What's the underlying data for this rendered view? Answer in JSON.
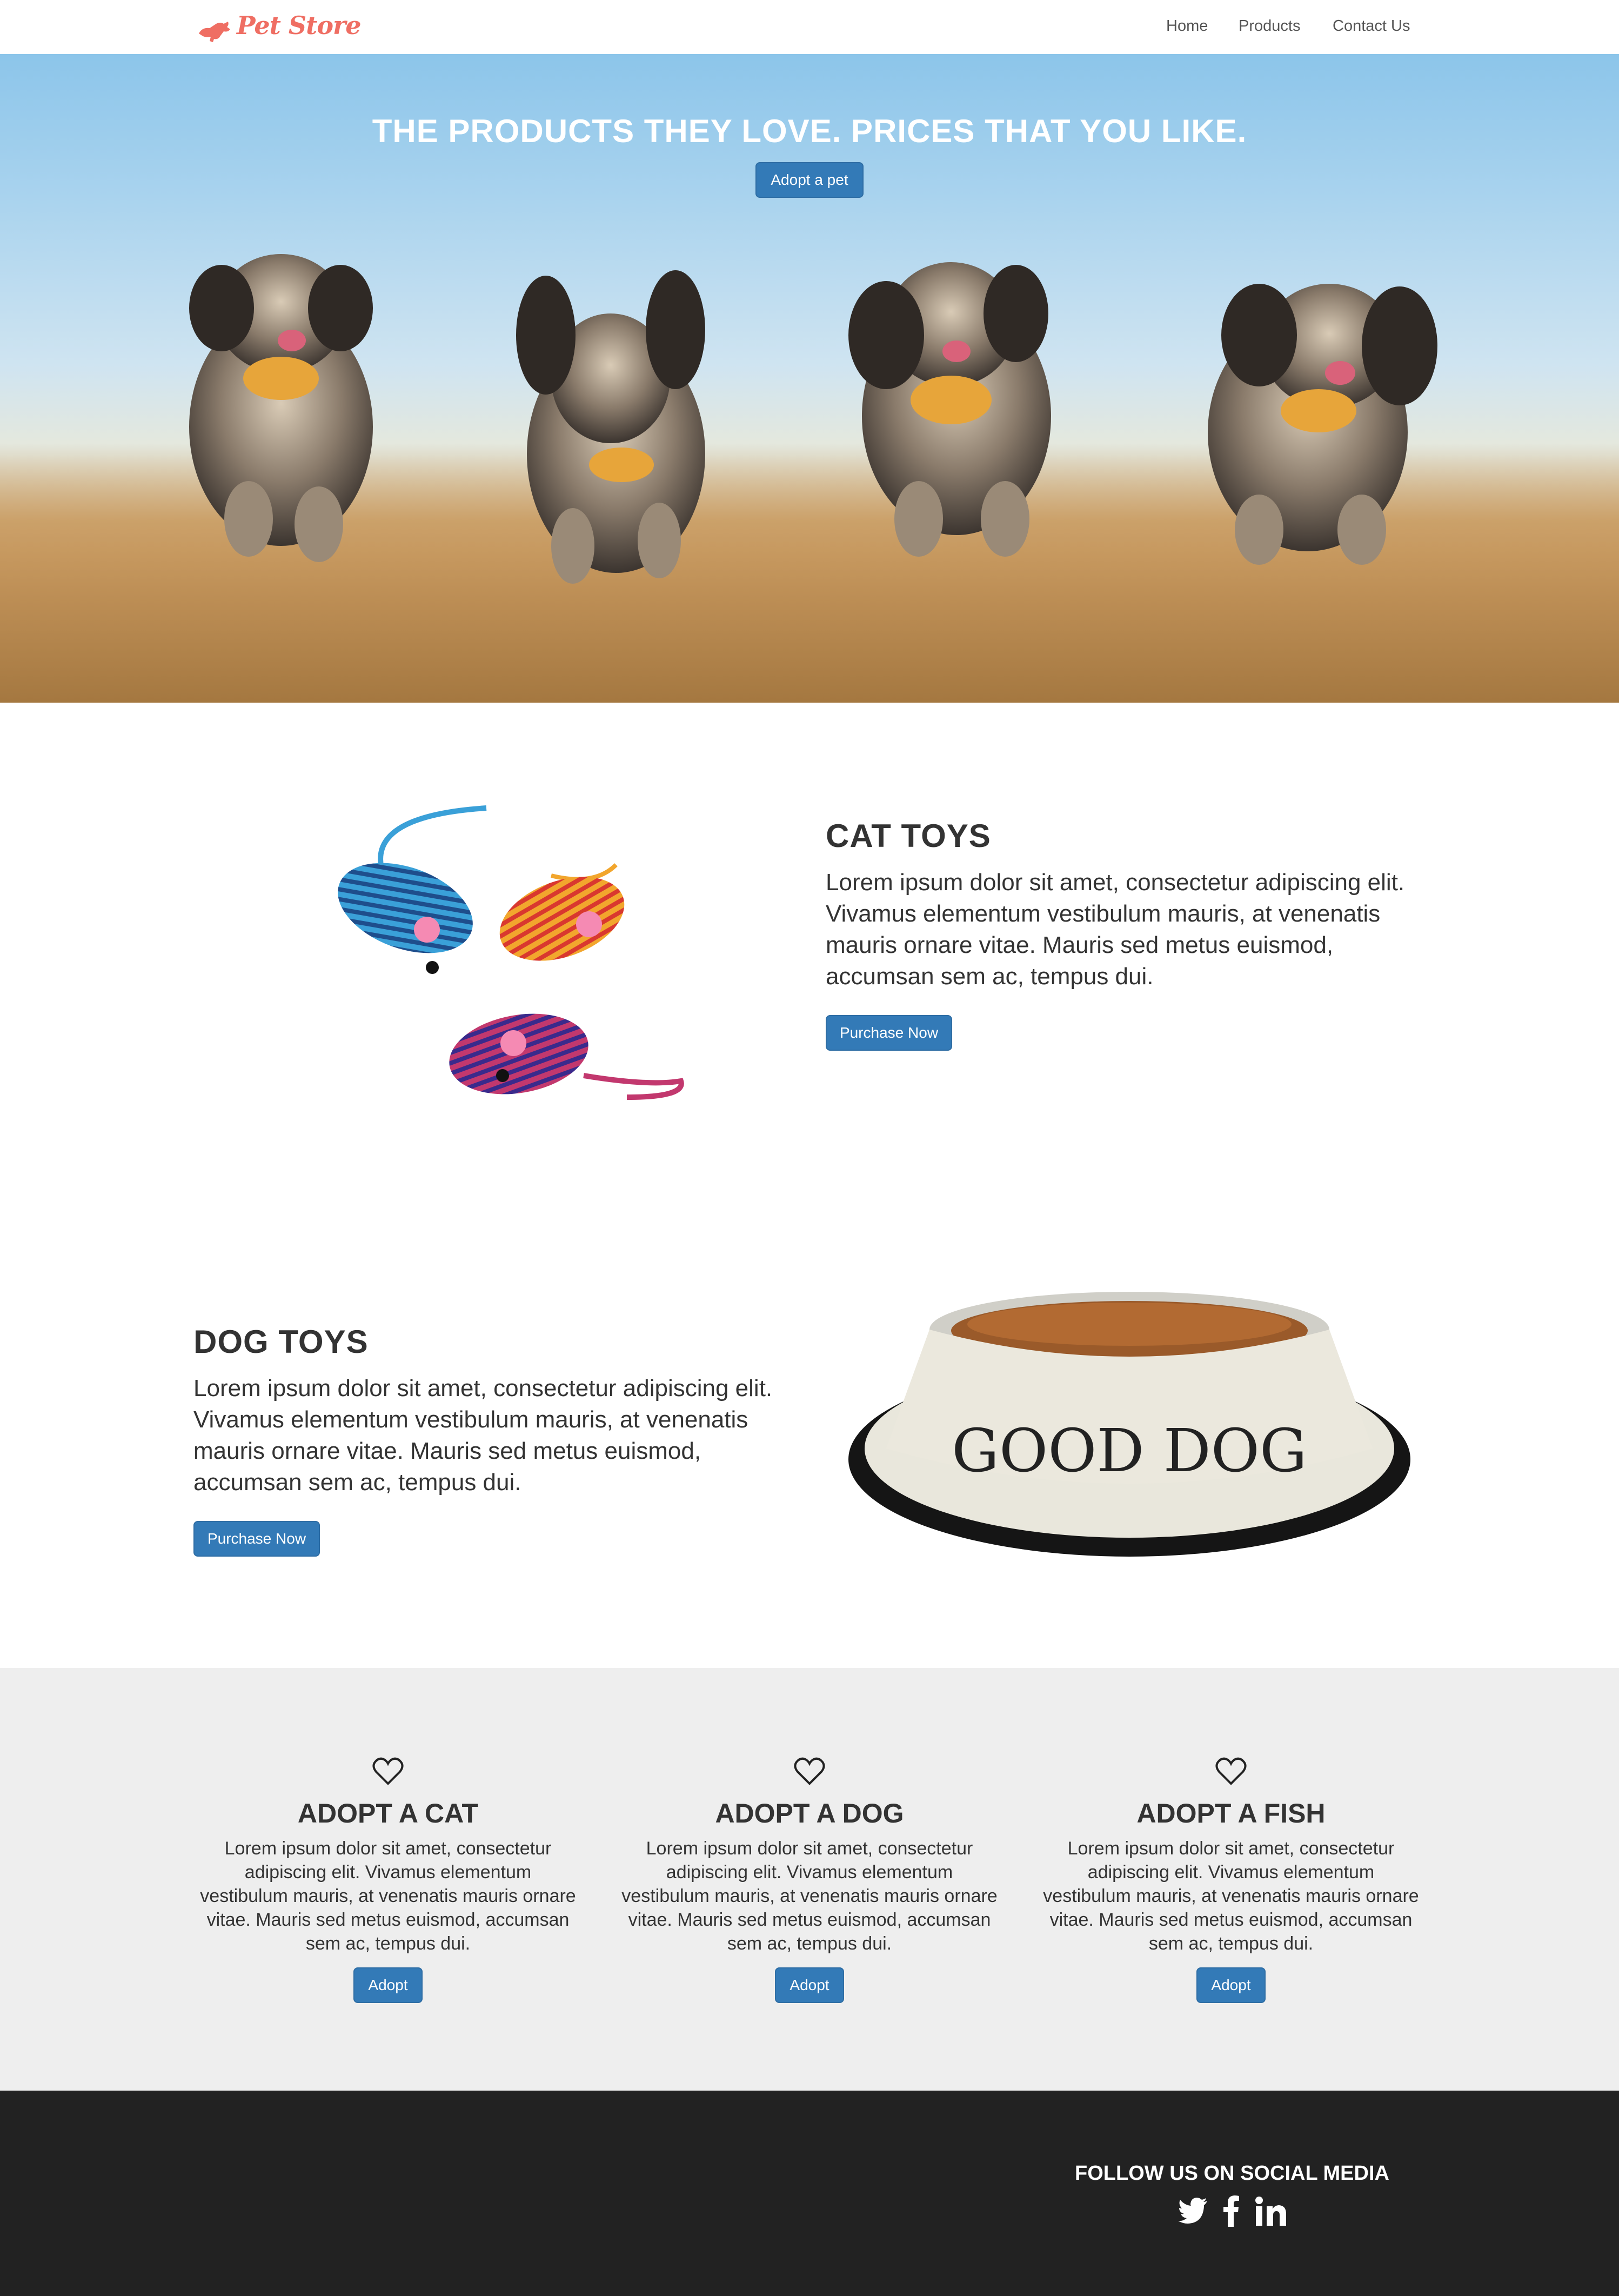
{
  "navbar": {
    "brand": "Pet Store",
    "links": [
      "Home",
      "Products",
      "Contact Us"
    ]
  },
  "hero": {
    "title": "THE PRODUCTS THEY LOVE. PRICES THAT YOU LIKE.",
    "button_label": "Adopt a pet"
  },
  "cat_toys": {
    "title": "CAT TOYS",
    "body": "Lorem ipsum dolor sit amet, consectetur adipiscing elit. Vivamus elementum vestibulum mauris, at venenatis mauris ornare vitae. Mauris sed metus euismod, accumsan sem ac, tempus dui.",
    "button_label": "Purchase Now"
  },
  "dog_toys": {
    "title": "DOG TOYS",
    "body": "Lorem ipsum dolor sit amet, consectetur adipiscing elit. Vivamus elementum vestibulum mauris, at venenatis mauris ornare vitae. Mauris sed metus euismod, accumsan sem ac, tempus dui.",
    "button_label": "Purchase Now",
    "bowl_text": "GOOD DOG"
  },
  "adopt": {
    "items": [
      {
        "title": "ADOPT A CAT",
        "body": "Lorem ipsum dolor sit amet, consectetur adipiscing elit. Vivamus elementum vestibulum mauris, at venenatis mauris ornare vitae. Mauris sed metus euismod, accumsan sem ac, tempus dui.",
        "button_label": "Adopt",
        "icon": "heart-icon"
      },
      {
        "title": "ADOPT A DOG",
        "body": "Lorem ipsum dolor sit amet, consectetur adipiscing elit. Vivamus elementum vestibulum mauris, at venenatis mauris ornare vitae. Mauris sed metus euismod, accumsan sem ac, tempus dui.",
        "button_label": "Adopt",
        "icon": "heart-icon"
      },
      {
        "title": "ADOPT A FISH",
        "body": "Lorem ipsum dolor sit amet, consectetur adipiscing elit. Vivamus elementum vestibulum mauris, at venenatis mauris ornare vitae. Mauris sed metus euismod, accumsan sem ac, tempus dui.",
        "button_label": "Adopt",
        "icon": "heart-icon"
      }
    ]
  },
  "footer": {
    "title": "FOLLOW US ON SOCIAL MEDIA",
    "icons": [
      "twitter-icon",
      "facebook-icon",
      "linkedin-icon"
    ]
  },
  "colors": {
    "brand": "#ef6e63",
    "primary_button": "#337ab7",
    "adopt_background": "#eeeeee",
    "footer_background": "#222222"
  }
}
